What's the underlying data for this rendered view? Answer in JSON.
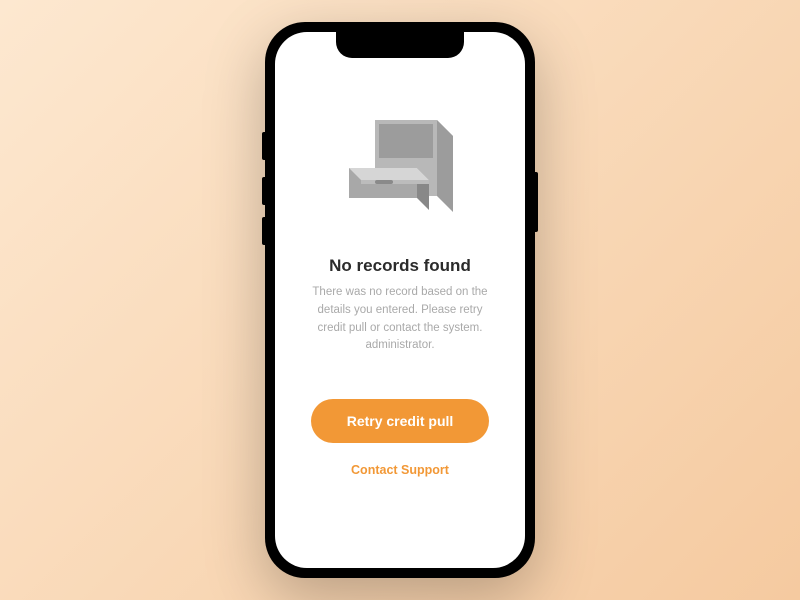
{
  "emptyState": {
    "title": "No records found",
    "subtitle": "There was no record based on the details you entered. Please retry credit pull or contact the system. administrator.",
    "primaryButtonLabel": "Retry credit pull",
    "secondaryLinkLabel": "Contact Support"
  },
  "colors": {
    "accent": "#f29836",
    "textPrimary": "#2b2b2b",
    "textSecondary": "#a9a9a9"
  }
}
